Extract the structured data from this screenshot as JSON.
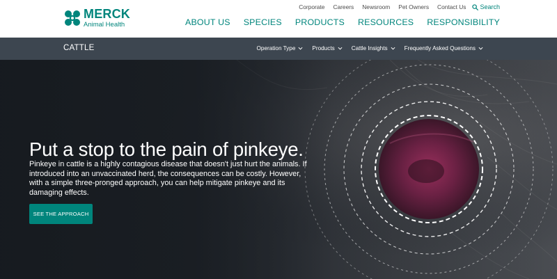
{
  "brand": {
    "name": "MERCK",
    "subtitle": "Animal Health",
    "logo_icon": "merck-logo-mark",
    "accent_color": "#00857c",
    "subnav_color": "#3d4650"
  },
  "utility_nav": {
    "links": [
      "Corporate",
      "Careers",
      "Newsroom",
      "Pet Owners",
      "Contact Us"
    ],
    "search_label": "Search",
    "search_icon": "search-icon"
  },
  "main_nav": {
    "items": [
      "ABOUT US",
      "SPECIES",
      "PRODUCTS",
      "RESOURCES",
      "RESPONSIBILITY"
    ]
  },
  "subnav": {
    "title": "CATTLE",
    "menus": [
      "Operation Type",
      "Products",
      "Cattle Insights",
      "Frequently Asked Questions"
    ],
    "menu_icon": "chevron-down-icon"
  },
  "hero": {
    "heading": "Put a stop to the pain of pinkeye.",
    "body": "Pinkeye in cattle is a highly contagious disease that doesn't just hurt the animals. If introduced into an unvaccinated herd, the consequences can be costly. However, with a simple three-pronged approach, you can help mitigate pinkeye and its damaging effects.",
    "cta_label": "SEE THE APPROACH",
    "image": "cattle-eye-closeup"
  }
}
